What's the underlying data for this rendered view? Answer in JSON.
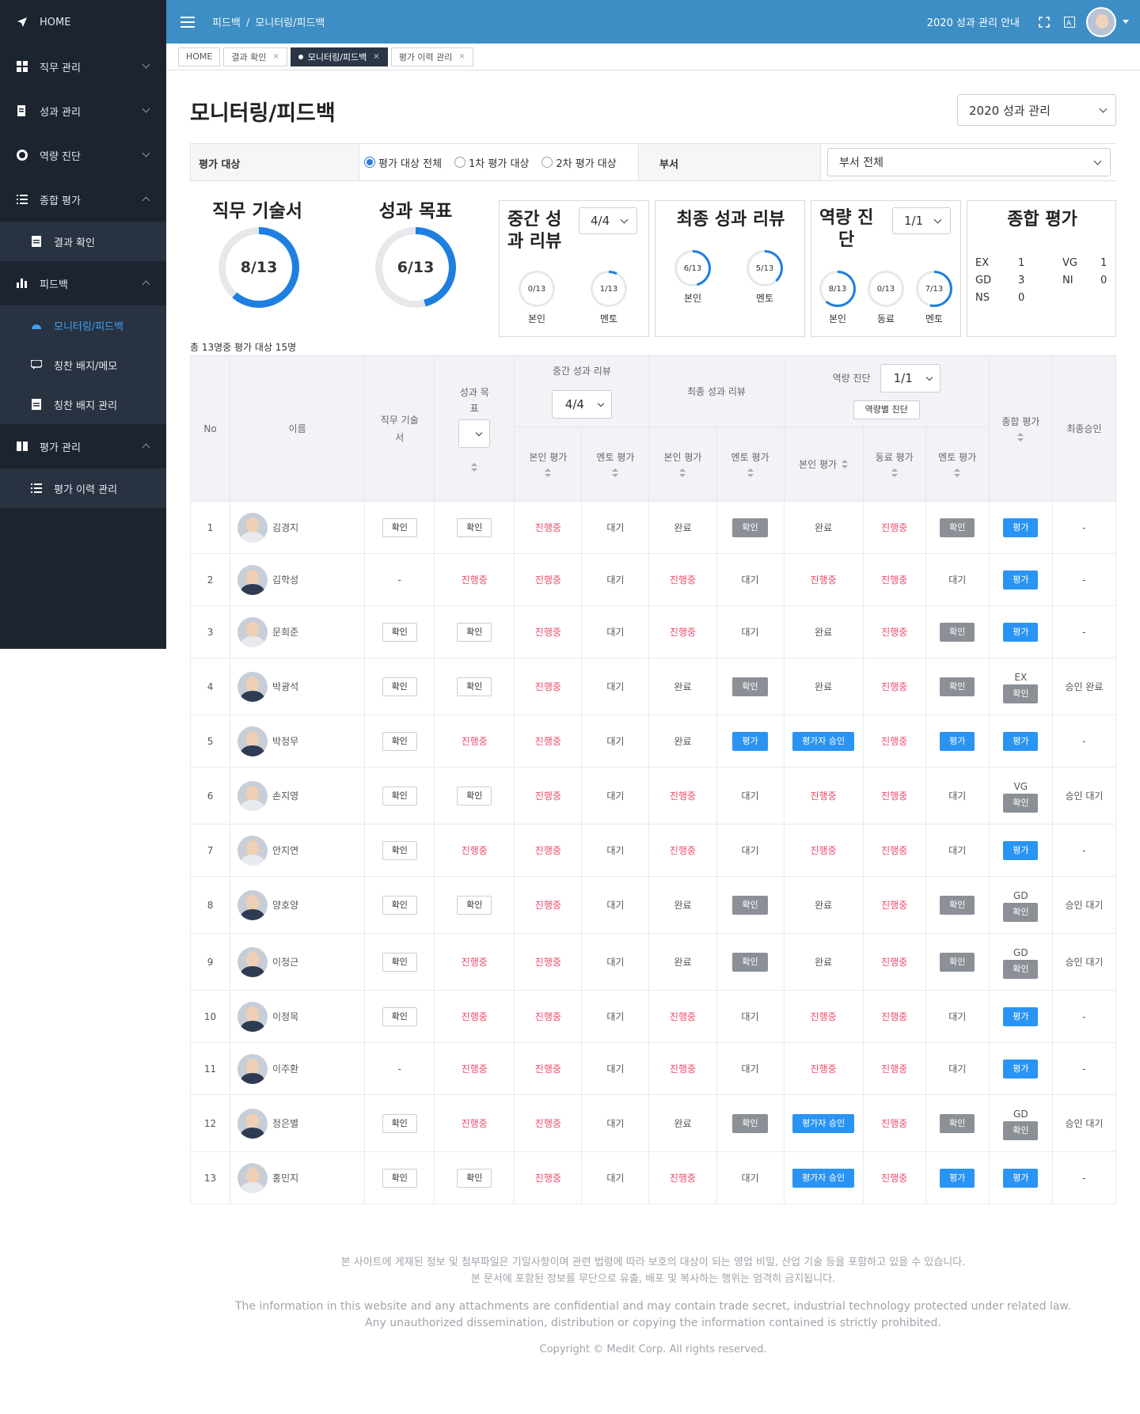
{
  "sidebar": {
    "items": [
      {
        "label": "HOME",
        "icon": "paper-plane-icon"
      },
      {
        "label": "직무 관리",
        "icon": "grid-icon"
      },
      {
        "label": "성과 관리",
        "icon": "document-edit-icon"
      },
      {
        "label": "역량 진단",
        "icon": "gear-icon"
      },
      {
        "label": "종합 평가",
        "icon": "list-icon"
      },
      {
        "label": "결과 확인",
        "icon": "document-icon"
      },
      {
        "label": "피드백",
        "icon": "bar-chart-icon"
      },
      {
        "label": "모니터링/피드백",
        "icon": "dashboard-icon"
      },
      {
        "label": "칭찬 배지/메모",
        "icon": "chat-icon"
      },
      {
        "label": "칭찬 배지 관리",
        "icon": "document-icon"
      },
      {
        "label": "평가 관리",
        "icon": "book-icon"
      },
      {
        "label": "평가 이력 관리",
        "icon": "list-icon"
      }
    ]
  },
  "topbar": {
    "breadcrumb": [
      "피드백",
      "모니터링/피드백"
    ],
    "guide": "2020 성과 관리 안내",
    "accent": "#3d8ec4"
  },
  "tabs": [
    {
      "label": "HOME",
      "closable": false
    },
    {
      "label": "결과 확인",
      "closable": true
    },
    {
      "label": "모니터링/피드백",
      "closable": true,
      "active": true
    },
    {
      "label": "평가 이력 관리",
      "closable": true
    }
  ],
  "page": {
    "title": "모니터링/피드백",
    "year_select": "2020 성과 관리"
  },
  "filter": {
    "target_label": "평가 대상",
    "radios": [
      "평가 대상 전체",
      "1차 평가 대상",
      "2차 평가 대상"
    ],
    "dept_label": "부서",
    "dept_select": "부서 전체"
  },
  "summary": {
    "job": {
      "title": "직무 기술서",
      "value": "8/13",
      "fraction": 0.615
    },
    "goal": {
      "title": "성과 목표",
      "value": "6/13",
      "fraction": 0.46
    },
    "mid": {
      "title_1": "중간 성",
      "title_2": "과 리뷰",
      "select": "4/4",
      "items": [
        {
          "label": "본인",
          "value": "0/13",
          "fraction": 0
        },
        {
          "label": "멘토",
          "value": "1/13",
          "fraction": 0.077
        }
      ]
    },
    "final": {
      "title": "최종 성과 리뷰",
      "items": [
        {
          "label": "본인",
          "value": "6/13",
          "fraction": 0.46
        },
        {
          "label": "멘토",
          "value": "5/13",
          "fraction": 0.385
        }
      ]
    },
    "comp": {
      "title_1": "역량 진",
      "title_2": "단",
      "select": "1/1",
      "items": [
        {
          "label": "본인",
          "value": "8/13",
          "fraction": 0.615
        },
        {
          "label": "동료",
          "value": "0/13",
          "fraction": 0
        },
        {
          "label": "멘토",
          "value": "7/13",
          "fraction": 0.538
        }
      ]
    },
    "overall": {
      "title": "종합 평가",
      "grades": [
        {
          "k": "EX",
          "v": "1"
        },
        {
          "k": "VG",
          "v": "1"
        },
        {
          "k": "GD",
          "v": "3"
        },
        {
          "k": "NI",
          "v": "0"
        },
        {
          "k": "NS",
          "v": "0"
        }
      ]
    }
  },
  "total_line": "총 13명중 평가 대상 15명",
  "table": {
    "headers": {
      "no": "No",
      "name": "이름",
      "job": "직무 기술서",
      "goal": "성과 목표",
      "mid": "중간 성과 리뷰",
      "mid_select": "4/4",
      "final": "최종 성과 리뷰",
      "comp": "역량 진단",
      "comp_select": "1/1",
      "comp_btn": "역량별 진단",
      "overall": "종합 평가",
      "approval": "최종승인",
      "self": "본인 평가",
      "mentor": "멘토 평가",
      "peer": "동료 평가"
    },
    "rows": [
      {
        "no": "1",
        "name": "김경지",
        "f": true,
        "job": "확인",
        "goal": "확인",
        "mid_self": "진행중",
        "mid_mentor": "대기",
        "fin_self": "완료",
        "fin_mentor": "확인",
        "c_self": "완료",
        "c_peer": "진행중",
        "c_mentor": "확인",
        "grade": "",
        "overall": "평가",
        "approval": "-"
      },
      {
        "no": "2",
        "name": "김학성",
        "f": false,
        "job": "-",
        "goal": "진행중",
        "mid_self": "진행중",
        "mid_mentor": "대기",
        "fin_self": "진행중",
        "fin_mentor": "대기",
        "c_self": "진행중",
        "c_peer": "진행중",
        "c_mentor": "대기",
        "grade": "",
        "overall": "평가",
        "approval": "-"
      },
      {
        "no": "3",
        "name": "문희준",
        "f": true,
        "job": "확인",
        "goal": "확인",
        "mid_self": "진행중",
        "mid_mentor": "대기",
        "fin_self": "진행중",
        "fin_mentor": "대기",
        "c_self": "완료",
        "c_peer": "진행중",
        "c_mentor": "확인",
        "grade": "",
        "overall": "평가",
        "approval": "-"
      },
      {
        "no": "4",
        "name": "박광석",
        "f": false,
        "job": "확인",
        "goal": "확인",
        "mid_self": "진행중",
        "mid_mentor": "대기",
        "fin_self": "완료",
        "fin_mentor": "확인",
        "c_self": "완료",
        "c_peer": "진행중",
        "c_mentor": "확인",
        "grade": "EX",
        "overall": "확인",
        "approval": "승인 완료"
      },
      {
        "no": "5",
        "name": "박정무",
        "f": false,
        "job": "확인",
        "goal": "진행중",
        "mid_self": "진행중",
        "mid_mentor": "대기",
        "fin_self": "완료",
        "fin_mentor": "평가",
        "c_self": "평가자 승인",
        "c_peer": "진행중",
        "c_mentor": "평가",
        "grade": "",
        "overall": "평가",
        "approval": "-"
      },
      {
        "no": "6",
        "name": "손지영",
        "f": true,
        "job": "확인",
        "goal": "확인",
        "mid_self": "진행중",
        "mid_mentor": "대기",
        "fin_self": "진행중",
        "fin_mentor": "대기",
        "c_self": "진행중",
        "c_peer": "진행중",
        "c_mentor": "대기",
        "grade": "VG",
        "overall": "확인",
        "approval": "승인 대기"
      },
      {
        "no": "7",
        "name": "안지연",
        "f": true,
        "job": "확인",
        "goal": "진행중",
        "mid_self": "진행중",
        "mid_mentor": "대기",
        "fin_self": "진행중",
        "fin_mentor": "대기",
        "c_self": "진행중",
        "c_peer": "진행중",
        "c_mentor": "대기",
        "grade": "",
        "overall": "평가",
        "approval": "-"
      },
      {
        "no": "8",
        "name": "양호양",
        "f": false,
        "job": "확인",
        "goal": "확인",
        "mid_self": "진행중",
        "mid_mentor": "대기",
        "fin_self": "완료",
        "fin_mentor": "확인",
        "c_self": "완료",
        "c_peer": "진행중",
        "c_mentor": "확인",
        "grade": "GD",
        "overall": "확인",
        "approval": "승인 대기"
      },
      {
        "no": "9",
        "name": "이정근",
        "f": false,
        "job": "확인",
        "goal": "진행중",
        "mid_self": "진행중",
        "mid_mentor": "대기",
        "fin_self": "완료",
        "fin_mentor": "확인",
        "c_self": "완료",
        "c_peer": "진행중",
        "c_mentor": "확인",
        "grade": "GD",
        "overall": "확인",
        "approval": "승인 대기"
      },
      {
        "no": "10",
        "name": "이정목",
        "f": false,
        "job": "확인",
        "goal": "진행중",
        "mid_self": "진행중",
        "mid_mentor": "대기",
        "fin_self": "진행중",
        "fin_mentor": "대기",
        "c_self": "진행중",
        "c_peer": "진행중",
        "c_mentor": "대기",
        "grade": "",
        "overall": "평가",
        "approval": "-"
      },
      {
        "no": "11",
        "name": "이주환",
        "f": false,
        "job": "-",
        "goal": "진행중",
        "mid_self": "진행중",
        "mid_mentor": "대기",
        "fin_self": "진행중",
        "fin_mentor": "대기",
        "c_self": "진행중",
        "c_peer": "진행중",
        "c_mentor": "대기",
        "grade": "",
        "overall": "평가",
        "approval": "-"
      },
      {
        "no": "12",
        "name": "정은별",
        "f": false,
        "job": "확인",
        "goal": "진행중",
        "mid_self": "진행중",
        "mid_mentor": "대기",
        "fin_self": "완료",
        "fin_mentor": "확인",
        "c_self": "평가자 승인",
        "c_peer": "진행중",
        "c_mentor": "확인",
        "grade": "GD",
        "overall": "확인",
        "approval": "승인 대기"
      },
      {
        "no": "13",
        "name": "홍민지",
        "f": true,
        "job": "확인",
        "goal": "확인",
        "mid_self": "진행중",
        "mid_mentor": "대기",
        "fin_self": "진행중",
        "fin_mentor": "대기",
        "c_self": "평가자 승인",
        "c_peer": "진행중",
        "c_mentor": "평가",
        "grade": "",
        "overall": "평가",
        "approval": "-"
      }
    ]
  },
  "footer": {
    "kr1": "본 사이트에 게재된 정보 및 첨부파일은 기밀사항이며 관련 법령에 따라 보호의 대상이 되는 영업 비밀, 산업 기술 등을 포함하고 있을 수 있습니다.",
    "kr2": "본 문서에 포함된 정보를 무단으로 유출, 배포 및 복사하는 행위는 엄격히 금지됩니다.",
    "en1": "The information in this website and any attachments are confidential and may contain trade secret, industrial technology protected under related law.",
    "en2": "Any unauthorized dissemination, distribution or copying the information contained is strictly prohibited.",
    "copyright": "Copyright © Medit Corp. All rights reserved."
  },
  "colors": {
    "ring": "#1e7fe0",
    "ring_track": "#e6e8eb",
    "red": "#ef4b6b",
    "btn_blue": "#2a94f4",
    "btn_gray": "#8b8f96"
  }
}
